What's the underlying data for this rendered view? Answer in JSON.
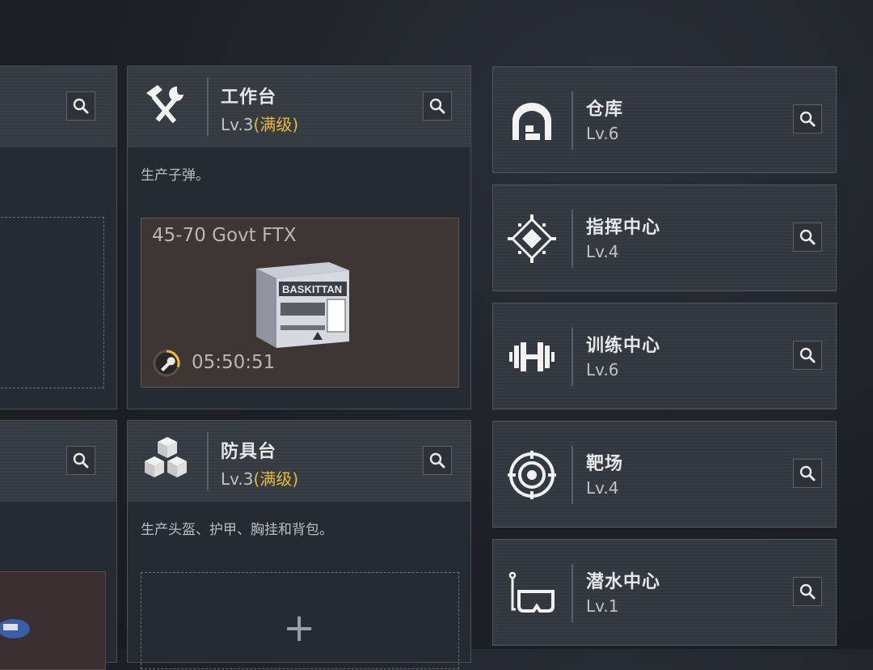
{
  "workbench": {
    "title": "工作台",
    "level": "Lv.3",
    "level_max": "(满级)",
    "description": "生产子弹。",
    "production": {
      "item_name": "45-70 Govt FTX",
      "timer": "05:50:51",
      "timer_progress": 0.3,
      "box_brand": "BASKITTAN"
    }
  },
  "armor_bench": {
    "title": "防具台",
    "level": "Lv.3",
    "level_max": "(满级)",
    "description": "生产头盔、护甲、胸挂和背包。",
    "add_symbol": "+"
  },
  "facilities": [
    {
      "title": "仓库",
      "level": "Lv.6",
      "icon": "warehouse-icon"
    },
    {
      "title": "指挥中心",
      "level": "Lv.4",
      "icon": "command-center-icon"
    },
    {
      "title": "训练中心",
      "level": "Lv.6",
      "icon": "dumbbell-icon"
    },
    {
      "title": "靶场",
      "level": "Lv.4",
      "icon": "target-icon"
    },
    {
      "title": "潜水中心",
      "level": "Lv.1",
      "icon": "diving-mask-icon"
    }
  ],
  "colors": {
    "accent_max": "#e8b93a",
    "panel": "#252b32",
    "header": "#343a41"
  }
}
